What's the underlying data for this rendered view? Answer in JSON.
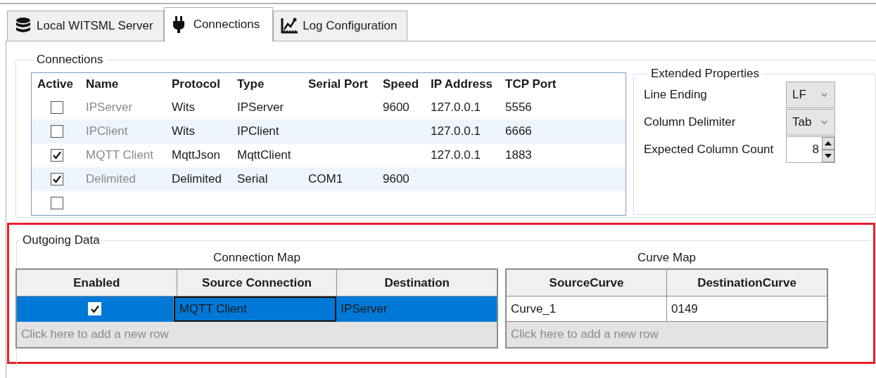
{
  "tabs": [
    {
      "label": "Local WITSML Server",
      "selected": false
    },
    {
      "label": "Connections",
      "selected": true
    },
    {
      "label": "Log Configuration",
      "selected": false
    }
  ],
  "connections": {
    "title": "Connections",
    "columns": [
      "Active",
      "Name",
      "Protocol",
      "Type",
      "Serial Port",
      "Speed",
      "IP Address",
      "TCP Port"
    ],
    "rows": [
      {
        "active": false,
        "name": "IPServer",
        "protocol": "Wits",
        "type": "IPServer",
        "speed": "9600",
        "ip_address": "127.0.0.1",
        "tcp_port": "5556"
      },
      {
        "active": false,
        "name": "IPClient",
        "protocol": "Wits",
        "type": "IPClient",
        "ip_address": "127.0.0.1",
        "tcp_port": "6666"
      },
      {
        "active": true,
        "name": "MQTT Client",
        "protocol": "MqttJson",
        "type": "MqttClient",
        "ip_address": "127.0.0.1",
        "tcp_port": "1883"
      },
      {
        "active": true,
        "name": "Delimited",
        "protocol": "Delimited",
        "type": "Serial",
        "serial_port": "COM1",
        "speed": "9600"
      },
      {
        "active": false
      }
    ]
  },
  "extended_properties": {
    "title": "Extended Properties",
    "fields": [
      {
        "kind": "dropdown",
        "label": "Line Ending",
        "value": "LF"
      },
      {
        "kind": "dropdown",
        "label": "Column Delimiter",
        "value": "Tab"
      },
      {
        "kind": "spinner",
        "label": "Expected Column Count",
        "value": "8"
      }
    ]
  },
  "outgoing_data": {
    "title": "Outgoing Data",
    "connection_map": {
      "title": "Connection Map",
      "columns": [
        "Enabled",
        "Source Connection",
        "Destination"
      ],
      "rows": [
        {
          "selected": true,
          "cells": [
            {
              "kind": "checkbox",
              "checked": true,
              "focused": false
            },
            {
              "kind": "text",
              "text": "MQTT Client",
              "focused": true
            },
            {
              "kind": "text",
              "text": "IPServer",
              "focused": false
            }
          ]
        }
      ],
      "new_row_hint": "Click here to add a new row"
    },
    "curve_map": {
      "title": "Curve Map",
      "columns": [
        "SourceCurve",
        "DestinationCurve"
      ],
      "rows": [
        {
          "selected": false,
          "cells": [
            {
              "kind": "text",
              "text": "Curve_1",
              "focused": false
            },
            {
              "kind": "text",
              "text": "0149",
              "focused": false
            }
          ]
        }
      ],
      "new_row_hint": "Click here to add a new row"
    }
  }
}
